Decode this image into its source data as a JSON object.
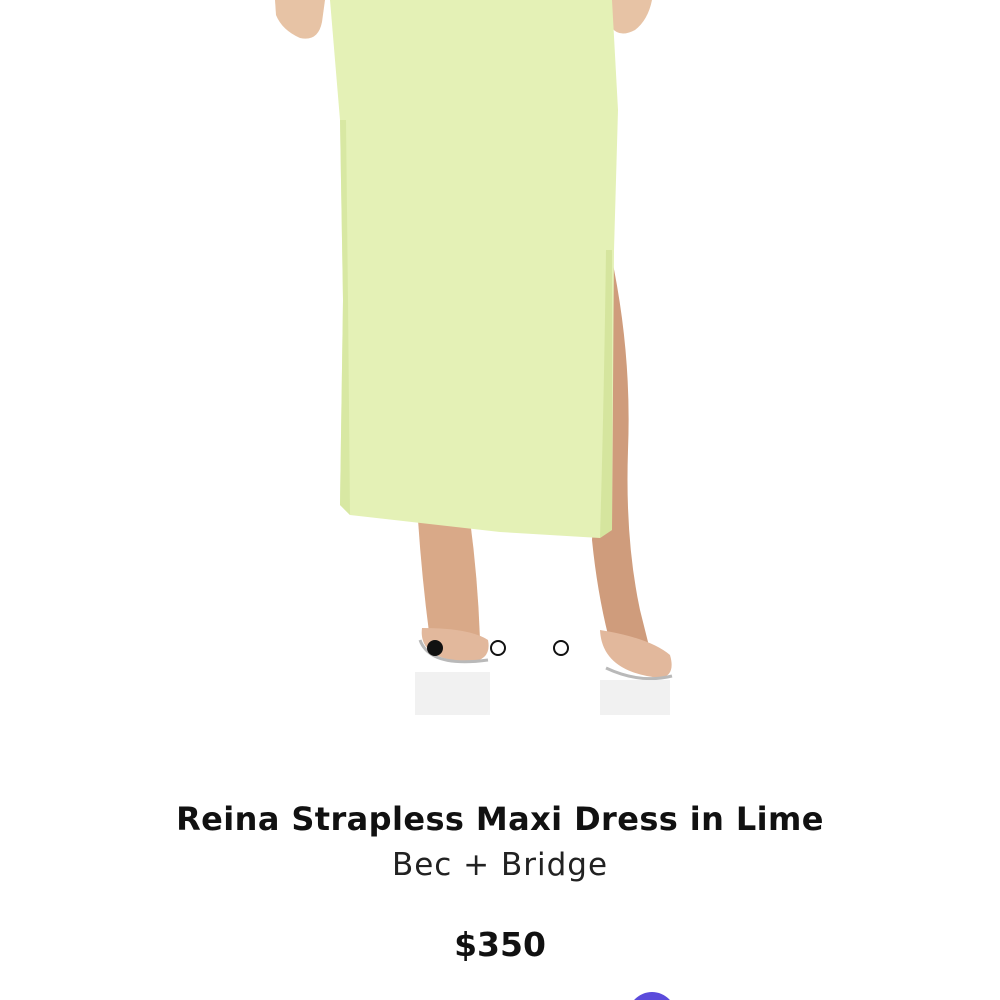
{
  "product": {
    "title": "Reina Strapless Maxi Dress in Lime",
    "brand": "Bec + Bridge",
    "price": "$350"
  },
  "gallery": {
    "image_count": 3,
    "active_index": 0
  },
  "colors": {
    "dress": "#e3f0b4",
    "accent_button": "#5b4bdb",
    "text": "#111111"
  }
}
